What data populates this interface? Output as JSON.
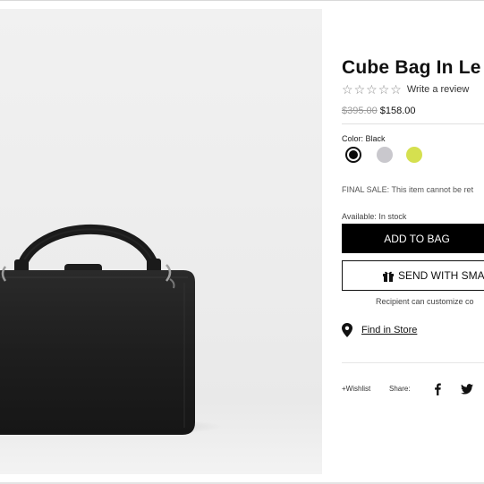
{
  "product": {
    "title": "Cube Bag In Le",
    "image_alt": "Black cube bag with top handle and strap rings",
    "rating": {
      "stars_filled": 0,
      "stars_total": 5,
      "review_link": "Write a review"
    },
    "price": {
      "original": "$395.00",
      "sale": "$158.00"
    },
    "color": {
      "label": "Color: Black",
      "swatches": [
        {
          "name": "black",
          "hex": "#0a0a0a",
          "selected": true
        },
        {
          "name": "grey",
          "hex": "#c9c8cd",
          "selected": false
        },
        {
          "name": "lime",
          "hex": "#d5e04f",
          "selected": false
        }
      ]
    },
    "sale_note": "FINAL SALE: This item cannot be ret",
    "availability": "Available: In stock",
    "add_to_bag_label": "ADD TO BAG",
    "gift_button_label": "SEND WITH SMAR",
    "gift_icon": "gift-icon",
    "recipient_note": "Recipient can customize co",
    "find_in_store": "Find in Store",
    "store_icon": "map-pin-icon"
  },
  "share": {
    "wishlist": "+Wishlist",
    "label": "Share:",
    "icons": [
      "facebook-icon",
      "twitter-icon"
    ]
  },
  "colors": {
    "button_primary": "#000000",
    "text": "#111111",
    "muted": "#999999"
  }
}
